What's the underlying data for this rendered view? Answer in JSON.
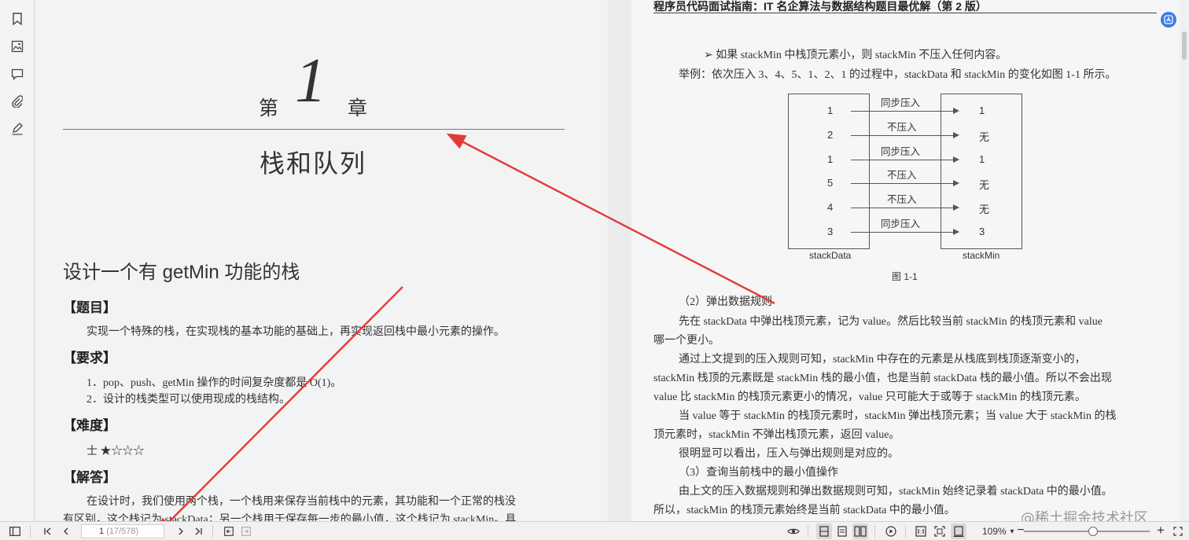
{
  "left_page": {
    "chapter_prefix": "第",
    "chapter_number": "1",
    "chapter_suffix": "章",
    "chapter_title": "栈和队列",
    "section_title": "设计一个有 getMin 功能的栈",
    "problem_heading": "【题目】",
    "problem_text": "实现一个特殊的栈，在实现栈的基本功能的基础上，再实现返回栈中最小元素的操作。",
    "requirements_heading": "【要求】",
    "requirement_1": "1．pop、push、getMin 操作的时间复杂度都是 O(1)。",
    "requirement_2": "2．设计的栈类型可以使用现成的栈结构。",
    "difficulty_heading": "【难度】",
    "difficulty_text": "士 ★☆☆☆",
    "answer_heading": "【解答】",
    "answer_line_1": "在设计时，我们使用两个栈，一个栈用来保存当前栈中的元素，其功能和一个正常的栈没",
    "answer_line_2": "有区别，这个栈记为 stackData；另一个栈用于保存每一步的最小值，这个栈记为 stackMin。具"
  },
  "right_page": {
    "running_head": "程序员代码面试指南：IT 名企算法与数据结构题目最优解（第 2 版）",
    "bullet_line": "➢  如果 stackMin 中栈顶元素小，则 stackMin 不压入任何内容。",
    "example_line": "举例：依次压入 3、4、5、1、2、1 的过程中，stackData 和 stackMin 的变化如图 1-1 所示。",
    "paragraphs": [
      "（2）弹出数据规则",
      "先在 stackData 中弹出栈顶元素，记为 value。然后比较当前 stackMin 的栈顶元素和 value",
      "哪一个更小。",
      "通过上文提到的压入规则可知，stackMin  中存在的元素是从栈底到栈顶逐渐变小的，",
      "stackMin 栈顶的元素既是 stackMin 栈的最小值，也是当前 stackData 栈的最小值。所以不会出现",
      "value 比 stackMin 的栈顶元素更小的情况，value 只可能大于或等于 stackMin 的栈顶元素。",
      "当 value 等于 stackMin 的栈顶元素时，stackMin 弹出栈顶元素；当 value 大于 stackMin 的栈",
      "顶元素时，stackMin 不弹出栈顶元素，返回 value。",
      "很明显可以看出，压入与弹出规则是对应的。",
      "（3）查询当前栈中的最小值操作",
      "由上文的压入数据规则和弹出数据规则可知，stackMin 始终记录着 stackData 中的最小值。",
      "所以，stackMin 的栈顶元素始终是当前 stackData 中的最小值。"
    ]
  },
  "figure": {
    "caption": "图 1-1",
    "left_label": "stackData",
    "right_label": "stackMin",
    "rows": [
      {
        "data": "1",
        "action": "同步压入",
        "min": "1"
      },
      {
        "data": "2",
        "action": "不压入",
        "min": "无"
      },
      {
        "data": "1",
        "action": "同步压入",
        "min": "1"
      },
      {
        "data": "5",
        "action": "不压入",
        "min": "无"
      },
      {
        "data": "4",
        "action": "不压入",
        "min": "无"
      },
      {
        "data": "3",
        "action": "同步压入",
        "min": "3"
      }
    ]
  },
  "toolbar": {
    "page_current": "1",
    "page_total": "(17/578)",
    "zoom_value": "109%",
    "zoom_minus": "−",
    "zoom_plus": "+"
  },
  "watermark": "@稀土掘金技术社区",
  "colors": {
    "annotation_arrow": "#e23a3a",
    "fab": "#3b7be8"
  }
}
